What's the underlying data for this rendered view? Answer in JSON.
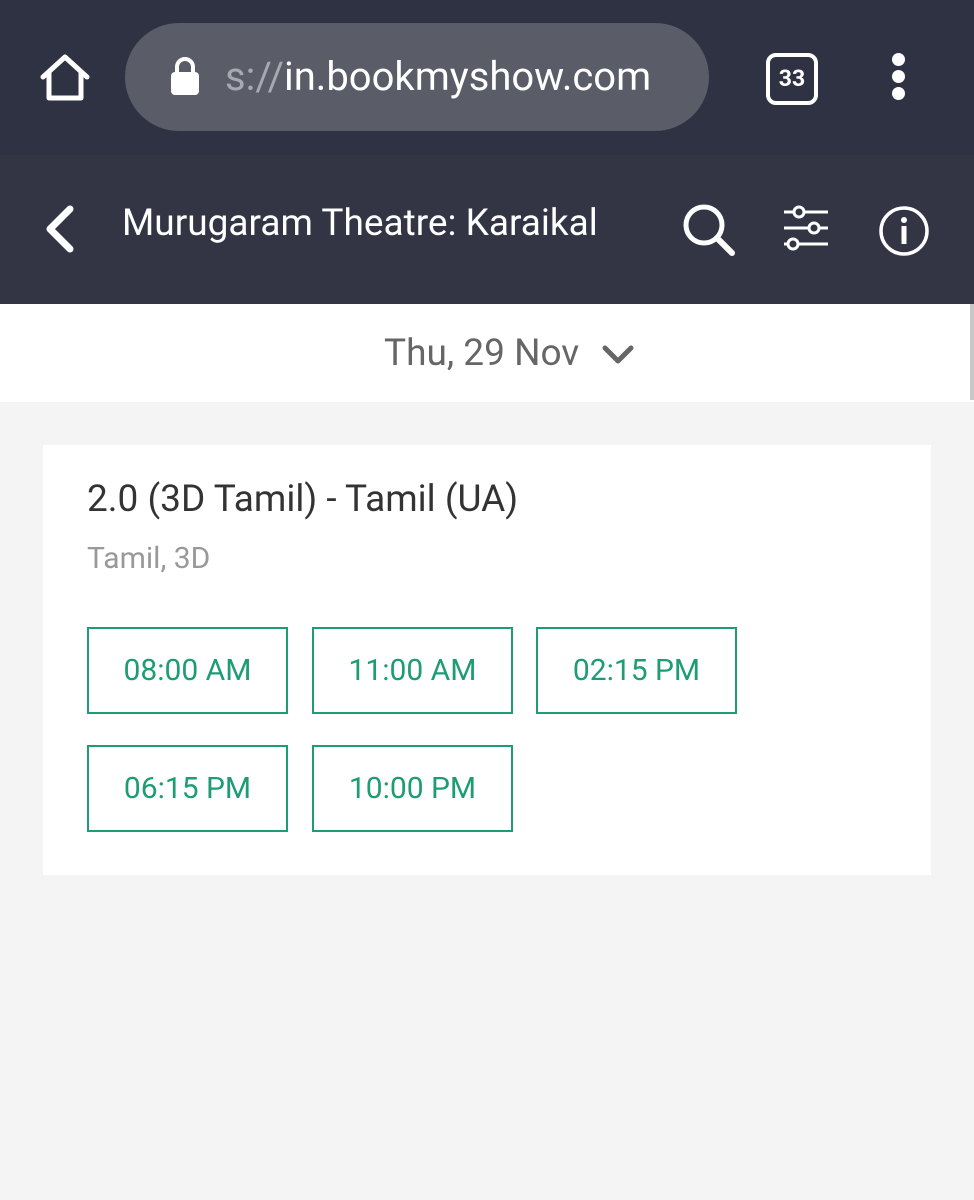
{
  "browser": {
    "url_scheme_fragment": "s://",
    "url_host": "in.bookmyshow.com",
    "tab_count": "33",
    "icons": {
      "home": "home-icon",
      "lock": "lock-icon",
      "menu": "kebab-menu-icon"
    }
  },
  "header": {
    "title": "Murugaram Theatre: Karaikal",
    "icons": {
      "back": "back-arrow-icon",
      "search": "search-icon",
      "filter": "sliders-icon",
      "info": "info-icon"
    }
  },
  "date_selector": {
    "selected": "Thu, 29 Nov",
    "icon": "chevron-down-icon"
  },
  "movie": {
    "title": "2.0 (3D Tamil) - Tamil (UA)",
    "meta": "Tamil, 3D",
    "showtimes": [
      "08:00 AM",
      "11:00 AM",
      "02:15 PM",
      "06:15 PM",
      "10:00 PM"
    ]
  },
  "colors": {
    "browser_bar": "#2f3242",
    "app_header": "#333545",
    "showtime_accent": "#1e9c73",
    "page_background": "#f4f4f4"
  }
}
